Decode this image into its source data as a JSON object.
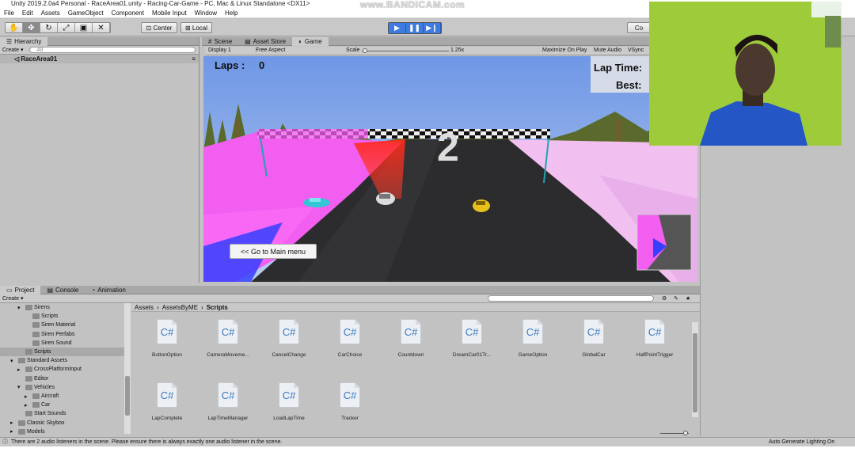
{
  "window_title": "Unity 2019.2.0a4 Personal - RaceArea01.unity - Racing-Car-Game - PC, Mac & Linux Standalone <DX11>",
  "watermark": "www.BANDICAM.com",
  "menu": [
    "File",
    "Edit",
    "Assets",
    "GameObject",
    "Component",
    "Mobile Input",
    "Window",
    "Help"
  ],
  "toolbar": {
    "pivot": "Center",
    "space": "Local",
    "collab": "Co"
  },
  "hierarchy": {
    "tab": "Hierarchy",
    "create": "Create",
    "search_placeholder": "All",
    "scene": "RaceArea01"
  },
  "center_tabs": [
    "Scene",
    "Asset Store",
    "Game"
  ],
  "game_toolbar": {
    "display": "Display 1",
    "aspect": "Free Aspect",
    "scale_label": "Scale",
    "scale_value": "1.25x",
    "maximize": "Maximize On Play",
    "mute": "Mute Audio",
    "vsync": "VSync"
  },
  "hud": {
    "laps_label": "Laps :",
    "laps_value": "0",
    "lap_time": "Lap Time:",
    "best": "Best:",
    "countdown": "2",
    "menu_button": "<< Go to Main menu"
  },
  "bottom_tabs": [
    "Project",
    "Console",
    "Animation"
  ],
  "project": {
    "create": "Create",
    "breadcrumb": [
      "Assets",
      "AssetsByME",
      "Scripts"
    ],
    "tree": [
      {
        "label": "Sirens",
        "indent": 2,
        "arrow": "down"
      },
      {
        "label": "Scripts",
        "indent": 3,
        "arrow": ""
      },
      {
        "label": "Siren Material",
        "indent": 3,
        "arrow": ""
      },
      {
        "label": "Siren Perfabs",
        "indent": 3,
        "arrow": ""
      },
      {
        "label": "Siren Sound",
        "indent": 3,
        "arrow": ""
      },
      {
        "label": "Scripts",
        "indent": 2,
        "arrow": "",
        "selected": true
      },
      {
        "label": "Standard Assets",
        "indent": 1,
        "arrow": "down"
      },
      {
        "label": "CrossPlatformInput",
        "indent": 2,
        "arrow": "right"
      },
      {
        "label": "Editor",
        "indent": 2,
        "arrow": ""
      },
      {
        "label": "Vehicles",
        "indent": 2,
        "arrow": "down"
      },
      {
        "label": "Aircraft",
        "indent": 3,
        "arrow": "right"
      },
      {
        "label": "Car",
        "indent": 3,
        "arrow": "right"
      },
      {
        "label": "Start Sounds",
        "indent": 2,
        "arrow": ""
      },
      {
        "label": "Classic Skybox",
        "indent": 1,
        "arrow": "right"
      },
      {
        "label": "Models",
        "indent": 1,
        "arrow": "right"
      }
    ],
    "assets": [
      "ButtonOption",
      "CameraMoveme...",
      "CancelChange",
      "CarChoice",
      "Countdown",
      "DreamCar01Tr...",
      "GameOption",
      "GlobalCar",
      "HalfPointTrigger",
      "LapComplete",
      "LapTimeManager",
      "LoadLapTime",
      "Tracker"
    ],
    "icon_text": "C#"
  },
  "status": {
    "message": "There are 2 audio listeners in the scene. Please ensure there is always exactly one audio listener in the scene.",
    "right": "Auto Generate Lighting On"
  },
  "colors": {
    "play_blue": "#3d7be0",
    "magenta": "#f15ef0",
    "sky": "#7aa2ea",
    "webcam_bg": "#9ecb3a"
  }
}
